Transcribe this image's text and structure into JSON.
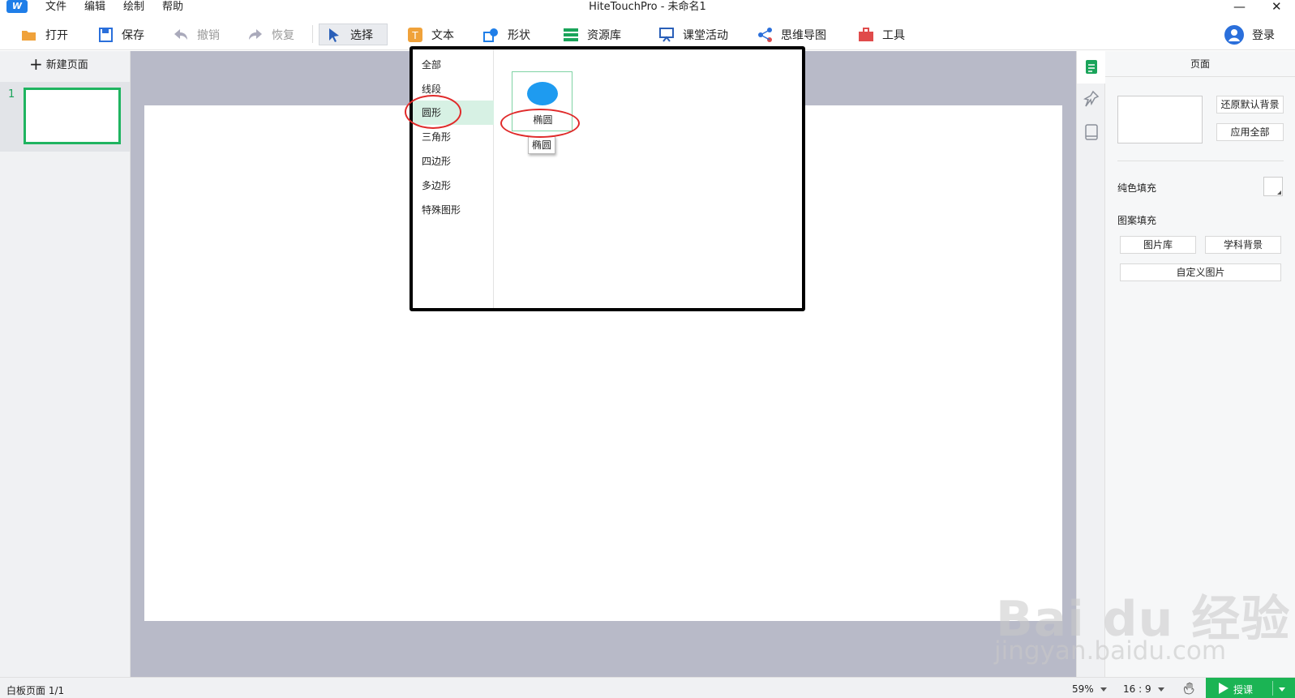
{
  "window": {
    "title": "HiteTouchPro - 未命名1",
    "minimize_glyph": "—",
    "close_glyph": "✕"
  },
  "menu": [
    "文件",
    "编辑",
    "绘制",
    "帮助"
  ],
  "toolbar": {
    "open": "打开",
    "save": "保存",
    "undo": "撤销",
    "redo": "恢复",
    "select": "选择",
    "text": "文本",
    "shape": "形状",
    "resources": "资源库",
    "class_activity": "课堂活动",
    "mindmap": "思维导图",
    "tools": "工具",
    "login": "登录",
    "colors": {
      "save": "#2a6fdb",
      "text": "#f0a23a",
      "shape": "#1f7ee8",
      "resources": "#1aa45a",
      "tools": "#e04b4b"
    }
  },
  "pages": {
    "new_page": "新建页面",
    "thumbnails": [
      {
        "number": "1"
      }
    ]
  },
  "shape_popup": {
    "categories": [
      "全部",
      "线段",
      "圆形",
      "三角形",
      "四边形",
      "多边形",
      "特殊图形"
    ],
    "selected_category": "圆形",
    "shapes": [
      {
        "label": "椭圆",
        "icon": "ellipse-shape",
        "color": "#1e9bf0"
      }
    ],
    "tooltip": "椭圆"
  },
  "properties": {
    "header": "页面",
    "restore_default_bg": "还原默认背景",
    "apply_all": "应用全部",
    "solid_fill": "纯色填充",
    "pattern_fill": "图案填充",
    "image_library": "图片库",
    "subject_background": "学科背景",
    "custom_image": "自定义图片"
  },
  "status": {
    "page_info": "白板页面 1/1",
    "zoom": "59%",
    "aspect": "16 : 9",
    "present": "授课"
  },
  "watermark": {
    "brand": "Bai du 经验",
    "url": "jingyan.baidu.com"
  }
}
